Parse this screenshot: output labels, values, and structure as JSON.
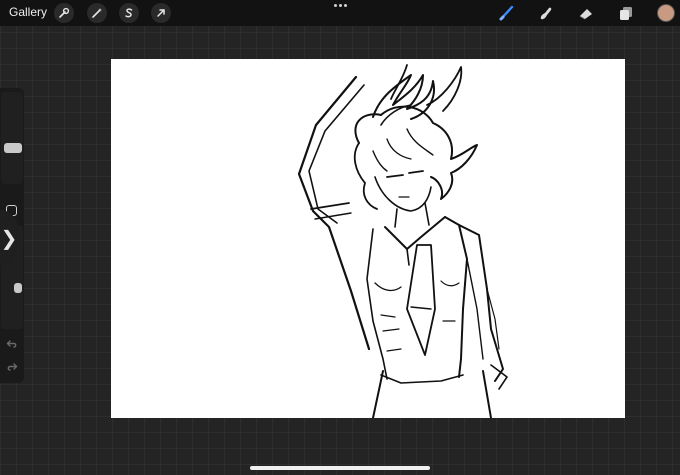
{
  "topbar": {
    "gallery_label": "Gallery",
    "left_tools": [
      {
        "name": "actions-wrench-icon"
      },
      {
        "name": "adjustments-wand-icon"
      },
      {
        "name": "selection-s-icon"
      },
      {
        "name": "transform-arrow-icon"
      }
    ],
    "right_tools": [
      {
        "name": "brush-icon",
        "active": true
      },
      {
        "name": "smudge-icon",
        "active": false
      },
      {
        "name": "eraser-icon",
        "active": false
      },
      {
        "name": "layers-icon",
        "active": false
      }
    ],
    "more_icon": "more-dots-icon",
    "current_color": "#c89a82",
    "accent_color": "#3b8cff"
  },
  "sidebar": {
    "brush_size_level": 0.4,
    "opacity_level": 0.4,
    "modify_icon": "square-modify-icon",
    "undo_icon": "undo-arrow-icon",
    "redo_icon": "redo-arrow-icon",
    "collapse_glyph": "❯"
  },
  "canvas": {
    "background": "#ffffff",
    "content": "line-art-character-drawing"
  }
}
